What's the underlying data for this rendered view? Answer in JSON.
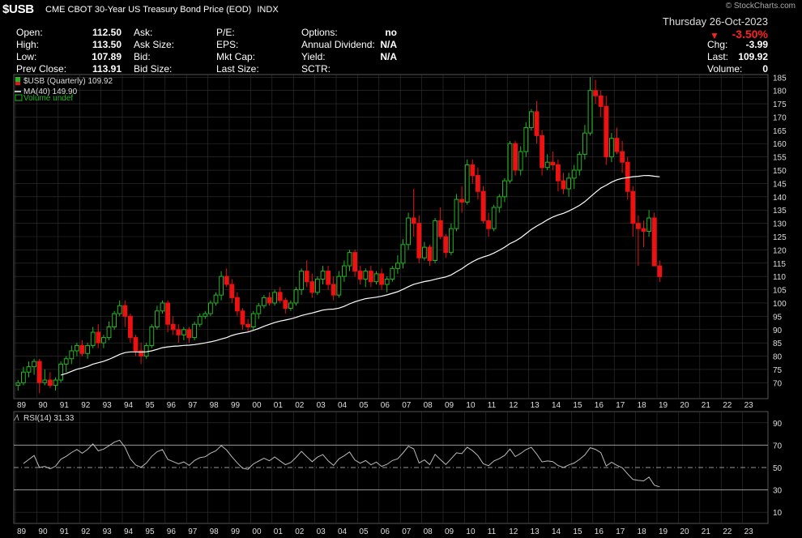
{
  "header": {
    "symbol": "$USB",
    "description": "CME CBOT 30-Year US Treasury Bond Price (EOD)",
    "exchange": "INDX",
    "watermark": "© StockCharts.com",
    "date": "Thursday  26-Oct-2023",
    "pct_change": "-3.50%",
    "down_color": "#ff2020"
  },
  "quote_labels": {
    "col1": [
      "Open:",
      "High:",
      "Low:",
      "Prev Close:"
    ],
    "col1_values": [
      "112.50",
      "113.50",
      "107.89",
      "113.91"
    ],
    "col2": [
      "Ask:",
      "Ask Size:",
      "Bid:",
      "Bid Size:"
    ],
    "col3": [
      "P/E:",
      "EPS:",
      "Mkt Cap:",
      "Last Size:"
    ],
    "col4": [
      "Options:",
      "Annual Dividend:",
      "Yield:",
      "SCTR:"
    ],
    "col4_values": [
      "no",
      "N/A",
      "N/A",
      ""
    ],
    "right_labels": [
      "Chg:",
      "Last:",
      "Volume:"
    ],
    "right_values": [
      "-3.99",
      "109.92",
      "0"
    ]
  },
  "legend": {
    "price": "$USB (Quarterly) 109.92",
    "ma": "MA(40) 149.90",
    "volume": "Volume undef",
    "rsi": "RSI(14) 31.33"
  },
  "chart_data": {
    "type": "candlestick",
    "period": "quarterly",
    "price_axis": {
      "ylim": [
        64,
        186
      ],
      "ticks": [
        70,
        75,
        80,
        85,
        90,
        95,
        100,
        105,
        110,
        115,
        120,
        125,
        130,
        135,
        140,
        145,
        150,
        155,
        160,
        165,
        170,
        175,
        180,
        185
      ]
    },
    "x_ticks": [
      "89",
      "90",
      "91",
      "92",
      "93",
      "94",
      "95",
      "96",
      "97",
      "98",
      "99",
      "00",
      "01",
      "02",
      "03",
      "04",
      "05",
      "06",
      "07",
      "08",
      "09",
      "10",
      "11",
      "12",
      "13",
      "14",
      "15",
      "16",
      "17",
      "18",
      "19",
      "20",
      "21",
      "22",
      "23"
    ],
    "first_quarter": "1989-Q1",
    "candles": [
      [
        69,
        71,
        67,
        70
      ],
      [
        70,
        76,
        69,
        74
      ],
      [
        74,
        78,
        72,
        76
      ],
      [
        76,
        79,
        73,
        78
      ],
      [
        78,
        79,
        66,
        70
      ],
      [
        70,
        75,
        69,
        71
      ],
      [
        71,
        74,
        68,
        69
      ],
      [
        69,
        72,
        67,
        71
      ],
      [
        71,
        78,
        70,
        77
      ],
      [
        77,
        80,
        74,
        79
      ],
      [
        79,
        84,
        77,
        82
      ],
      [
        82,
        85,
        80,
        84
      ],
      [
        84,
        86,
        80,
        81
      ],
      [
        81,
        85,
        79,
        84
      ],
      [
        84,
        91,
        83,
        89
      ],
      [
        89,
        92,
        83,
        85
      ],
      [
        85,
        88,
        83,
        87
      ],
      [
        87,
        93,
        86,
        91
      ],
      [
        91,
        97,
        90,
        96
      ],
      [
        96,
        101,
        95,
        99
      ],
      [
        99,
        101,
        91,
        95
      ],
      [
        95,
        96,
        85,
        87
      ],
      [
        87,
        88,
        80,
        82
      ],
      [
        82,
        85,
        77,
        80
      ],
      [
        80,
        85,
        79,
        84
      ],
      [
        84,
        92,
        83,
        91
      ],
      [
        91,
        99,
        90,
        97
      ],
      [
        97,
        101,
        96,
        100
      ],
      [
        100,
        101,
        89,
        92
      ],
      [
        92,
        95,
        88,
        90
      ],
      [
        90,
        92,
        85,
        88
      ],
      [
        88,
        91,
        86,
        90
      ],
      [
        90,
        91,
        85,
        87
      ],
      [
        87,
        93,
        86,
        92
      ],
      [
        92,
        96,
        91,
        95
      ],
      [
        95,
        97,
        94,
        96
      ],
      [
        96,
        101,
        95,
        100
      ],
      [
        100,
        104,
        99,
        103
      ],
      [
        103,
        112,
        101,
        110
      ],
      [
        110,
        113,
        106,
        107
      ],
      [
        107,
        109,
        100,
        102
      ],
      [
        102,
        104,
        95,
        97
      ],
      [
        97,
        98,
        90,
        92
      ],
      [
        92,
        94,
        89,
        91
      ],
      [
        91,
        97,
        90,
        96
      ],
      [
        96,
        100,
        94,
        99
      ],
      [
        99,
        103,
        98,
        102
      ],
      [
        102,
        104,
        99,
        100
      ],
      [
        100,
        105,
        99,
        104
      ],
      [
        104,
        106,
        100,
        101
      ],
      [
        101,
        102,
        96,
        98
      ],
      [
        98,
        101,
        97,
        100
      ],
      [
        100,
        106,
        99,
        105
      ],
      [
        105,
        113,
        103,
        112
      ],
      [
        112,
        116,
        106,
        108
      ],
      [
        108,
        111,
        102,
        104
      ],
      [
        104,
        110,
        103,
        109
      ],
      [
        109,
        114,
        107,
        112
      ],
      [
        112,
        114,
        105,
        107
      ],
      [
        107,
        110,
        101,
        103
      ],
      [
        103,
        112,
        102,
        110
      ],
      [
        110,
        116,
        108,
        114
      ],
      [
        114,
        120,
        112,
        119
      ],
      [
        119,
        120,
        110,
        112
      ],
      [
        112,
        114,
        107,
        109
      ],
      [
        109,
        113,
        106,
        112
      ],
      [
        112,
        114,
        106,
        108
      ],
      [
        108,
        112,
        107,
        111
      ],
      [
        111,
        113,
        105,
        107
      ],
      [
        107,
        110,
        104,
        109
      ],
      [
        109,
        114,
        108,
        113
      ],
      [
        113,
        118,
        111,
        115
      ],
      [
        115,
        124,
        113,
        122
      ],
      [
        122,
        134,
        120,
        132
      ],
      [
        132,
        143,
        125,
        130
      ],
      [
        130,
        133,
        115,
        117
      ],
      [
        117,
        123,
        116,
        121
      ],
      [
        121,
        122,
        114,
        116
      ],
      [
        116,
        132,
        115,
        131
      ],
      [
        131,
        136,
        124,
        125
      ],
      [
        125,
        126,
        117,
        119
      ],
      [
        119,
        130,
        118,
        128
      ],
      [
        128,
        141,
        127,
        139
      ],
      [
        139,
        144,
        134,
        138
      ],
      [
        138,
        154,
        137,
        152
      ],
      [
        152,
        154,
        145,
        148
      ],
      [
        148,
        151,
        139,
        142
      ],
      [
        142,
        144,
        130,
        131
      ],
      [
        131,
        134,
        125,
        128
      ],
      [
        128,
        137,
        127,
        136
      ],
      [
        136,
        141,
        134,
        140
      ],
      [
        140,
        147,
        138,
        146
      ],
      [
        146,
        161,
        145,
        160
      ],
      [
        160,
        161,
        148,
        150
      ],
      [
        150,
        159,
        148,
        157
      ],
      [
        157,
        168,
        155,
        166
      ],
      [
        166,
        173,
        165,
        172
      ],
      [
        172,
        176,
        160,
        163
      ],
      [
        163,
        165,
        148,
        151
      ],
      [
        151,
        156,
        150,
        153
      ],
      [
        153,
        157,
        150,
        152
      ],
      [
        152,
        154,
        142,
        146
      ],
      [
        146,
        149,
        141,
        143
      ],
      [
        143,
        149,
        140,
        147
      ],
      [
        147,
        152,
        143,
        150
      ],
      [
        150,
        157,
        148,
        156
      ],
      [
        156,
        167,
        154,
        164
      ],
      [
        164,
        185,
        163,
        180
      ],
      [
        180,
        184,
        175,
        178
      ],
      [
        178,
        180,
        170,
        174
      ],
      [
        174,
        178,
        152,
        155
      ],
      [
        155,
        164,
        153,
        162
      ],
      [
        162,
        166,
        156,
        157
      ],
      [
        157,
        161,
        149,
        153
      ],
      [
        153,
        155,
        139,
        142
      ],
      [
        142,
        144,
        125,
        130
      ],
      [
        130,
        133,
        114,
        128
      ],
      [
        128,
        131,
        121,
        127
      ],
      [
        127,
        135,
        125,
        132
      ],
      [
        132,
        134,
        115,
        114
      ],
      [
        114,
        116,
        107.89,
        109.92
      ]
    ],
    "ma": {
      "name": "MA(40)",
      "last": 149.9
    },
    "rsi": {
      "name": "RSI(14)",
      "ylim": [
        0,
        100
      ],
      "ticks": [
        10,
        30,
        50,
        70,
        90
      ],
      "levels": [
        30,
        50,
        70
      ],
      "last": 31.33
    },
    "colors": {
      "up": "#22b822",
      "down": "#ee1111",
      "ma": "#ffffff",
      "rsi": "#bbbbbb",
      "grid": "#333333"
    }
  }
}
